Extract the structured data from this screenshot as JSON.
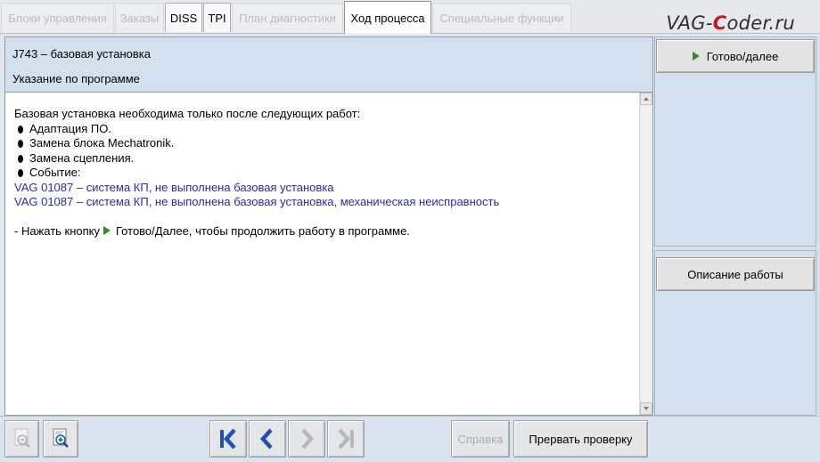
{
  "tabs": [
    {
      "label": "Блоки управления",
      "state": "disabled"
    },
    {
      "label": "Заказы",
      "state": "disabled"
    },
    {
      "label": "DISS",
      "state": "enabled"
    },
    {
      "label": "TPI",
      "state": "enabled"
    },
    {
      "label": "План диагностики",
      "state": "disabled"
    },
    {
      "label": "Ход процесса",
      "state": "active"
    },
    {
      "label": "Специальные функции",
      "state": "disabled"
    }
  ],
  "watermark": {
    "before": "VAG-",
    "highlight": "C",
    "after": "oder.ru"
  },
  "header": {
    "title": "J743 – базовая установка",
    "subtitle": "Указание по программе"
  },
  "content": {
    "intro": "Базовая установка необходима только после следующих работ:",
    "bullets": [
      "Адаптация ПО.",
      "Замена блока Mechatronik.",
      "Замена сцепления.",
      "Событие:"
    ],
    "links": [
      "VAG 01087 – система КП, не выполнена базовая установка",
      "VAG 01087 – система КП, не выполнена базовая установка, механическая неисправность"
    ],
    "instruction_before": "- Нажать кнопку",
    "instruction_after": "Готово/Далее, чтобы продолжить работу в программе."
  },
  "right_panel": {
    "next_label": "Готово/далее",
    "description_label": "Описание работы"
  },
  "toolbar": {
    "help_label": "Справка",
    "abort_label": "Прервать проверку"
  },
  "colors": {
    "link": "#2a2ab4",
    "play_green": "#2f8f1c",
    "nav_blue": "#1f4fb8",
    "panel_bg": "#d3e1ee"
  },
  "icons": {
    "zoom_out": "zoom-out-icon",
    "zoom_in": "zoom-in-icon",
    "first": "skip-first-icon",
    "prev": "previous-icon",
    "next": "next-icon",
    "last": "skip-last-icon",
    "play": "play-icon"
  }
}
